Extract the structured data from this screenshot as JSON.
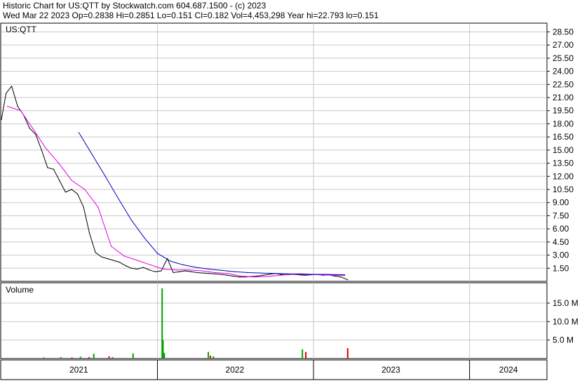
{
  "header": {
    "line1": "Historic Chart for US:QTT by Stockwatch.com 604.687.1500 - (c) 2023",
    "line2": "Wed Mar 22 2023   Op=0.2838   Hi=0.2851   Lo=0.151   Cl=0.182   Vol=4,453,298   Year hi=22.793   lo=0.151"
  },
  "colors": {
    "price": "#000000",
    "ma_short": "#e000e0",
    "ma_long": "#0000c0",
    "vol_up": "#00a000",
    "vol_down": "#e00000",
    "grid": "#c8c8c8"
  },
  "chart_data": [
    {
      "type": "line",
      "title": "US:QTT",
      "ylabel": "",
      "ylim": [
        0,
        29.5
      ],
      "yticks": [
        "1.50",
        "3.00",
        "4.50",
        "6.00",
        "7.50",
        "9.00",
        "10.50",
        "12.00",
        "13.50",
        "15.00",
        "16.50",
        "18.00",
        "19.50",
        "21.00",
        "22.50",
        "24.00",
        "25.50",
        "27.00",
        "28.50"
      ],
      "xlim": [
        "2021-01-01",
        "2024-06-30"
      ],
      "series": [
        {
          "role": "price",
          "x": [
            "2021-01-01",
            "2021-01-12",
            "2021-01-25",
            "2021-02-08",
            "2021-02-22",
            "2021-03-08",
            "2021-03-22",
            "2021-04-05",
            "2021-04-19",
            "2021-05-03",
            "2021-05-17",
            "2021-05-31",
            "2021-06-14",
            "2021-06-28",
            "2021-07-12",
            "2021-07-26",
            "2021-08-09",
            "2021-08-23",
            "2021-09-06",
            "2021-09-20",
            "2021-10-04",
            "2021-10-18",
            "2021-11-01",
            "2021-11-15",
            "2021-11-29",
            "2021-12-13",
            "2021-12-27",
            "2022-01-10",
            "2022-01-24",
            "2022-02-07",
            "2022-02-21",
            "2022-03-07",
            "2022-03-21",
            "2022-04-04",
            "2022-04-18",
            "2022-05-02",
            "2022-05-16",
            "2022-05-30",
            "2022-06-13",
            "2022-06-27",
            "2022-07-11",
            "2022-07-25",
            "2022-08-08",
            "2022-08-22",
            "2022-09-05",
            "2022-09-19",
            "2022-10-03",
            "2022-10-17",
            "2022-10-31",
            "2022-11-14",
            "2022-11-28",
            "2022-12-12",
            "2022-12-26",
            "2023-01-09",
            "2023-01-23",
            "2023-02-06",
            "2023-02-20",
            "2023-03-06",
            "2023-03-22"
          ],
          "y": [
            18.5,
            21.5,
            22.3,
            20.0,
            19.0,
            17.5,
            16.8,
            15.0,
            13.0,
            12.8,
            11.5,
            10.2,
            10.5,
            10.0,
            8.5,
            5.5,
            3.3,
            2.8,
            2.6,
            2.4,
            2.2,
            1.8,
            1.5,
            1.4,
            1.6,
            1.3,
            1.1,
            1.2,
            2.6,
            1.0,
            1.1,
            1.2,
            1.1,
            1.0,
            0.95,
            0.9,
            0.85,
            0.8,
            0.7,
            0.6,
            0.5,
            0.5,
            0.55,
            0.6,
            0.7,
            0.8,
            0.9,
            0.8,
            0.85,
            0.8,
            0.75,
            0.7,
            0.75,
            0.8,
            0.7,
            0.75,
            0.6,
            0.5,
            0.182
          ]
        },
        {
          "role": "ma_short",
          "x": [
            "2021-01-15",
            "2021-02-15",
            "2021-03-15",
            "2021-04-15",
            "2021-05-15",
            "2021-06-15",
            "2021-07-15",
            "2021-08-15",
            "2021-09-15",
            "2021-10-15",
            "2021-11-15",
            "2021-12-15",
            "2022-01-15",
            "2022-02-15",
            "2022-03-15",
            "2022-04-15",
            "2022-05-15",
            "2022-06-15",
            "2022-07-15",
            "2022-08-15",
            "2022-09-15",
            "2022-10-15",
            "2022-11-15",
            "2022-12-15",
            "2023-01-15",
            "2023-02-15",
            "2023-03-15"
          ],
          "y": [
            20.0,
            19.5,
            17.5,
            15.2,
            13.5,
            11.5,
            10.5,
            8.5,
            4.0,
            2.9,
            2.4,
            1.9,
            1.4,
            1.3,
            1.3,
            1.2,
            1.0,
            0.9,
            0.6,
            0.5,
            0.55,
            0.7,
            0.8,
            0.8,
            0.75,
            0.7,
            0.65
          ]
        },
        {
          "role": "ma_long",
          "x": [
            "2021-07-01",
            "2021-08-01",
            "2021-09-01",
            "2021-10-01",
            "2021-11-01",
            "2021-12-01",
            "2022-01-01",
            "2022-02-01",
            "2022-03-01",
            "2022-04-01",
            "2022-05-01",
            "2022-06-01",
            "2022-07-01",
            "2022-08-01",
            "2022-09-01",
            "2022-10-01",
            "2022-11-01",
            "2022-12-01",
            "2023-01-01",
            "2023-02-01",
            "2023-03-15"
          ],
          "y": [
            17.0,
            14.5,
            12.0,
            9.5,
            7.0,
            5.0,
            3.2,
            2.3,
            1.9,
            1.6,
            1.4,
            1.25,
            1.1,
            1.0,
            0.95,
            0.9,
            0.85,
            0.85,
            0.8,
            0.8,
            0.75
          ]
        }
      ]
    },
    {
      "type": "bar",
      "title": "Volume",
      "ylim": [
        0,
        20.5
      ],
      "yticks": [
        "5.0 M",
        "10.0 M",
        "15.0 M"
      ],
      "x": [
        "2021-04-10",
        "2021-05-20",
        "2021-06-15",
        "2021-07-05",
        "2021-07-25",
        "2021-08-05",
        "2021-09-10",
        "2021-09-18",
        "2021-11-05",
        "2022-01-12",
        "2022-01-14",
        "2022-01-17",
        "2022-04-30",
        "2022-05-05",
        "2022-05-12",
        "2022-12-06",
        "2022-12-14",
        "2023-03-22"
      ],
      "values": [
        0.3,
        0.4,
        0.3,
        0.5,
        0.4,
        1.3,
        0.6,
        0.4,
        1.4,
        19.0,
        5.0,
        1.5,
        1.8,
        0.8,
        0.6,
        2.5,
        1.8,
        2.8
      ],
      "up": [
        true,
        true,
        false,
        true,
        false,
        true,
        false,
        true,
        true,
        true,
        true,
        true,
        true,
        false,
        true,
        true,
        false,
        false
      ]
    }
  ],
  "x_axis": {
    "labels": [
      "2021",
      "2022",
      "2023",
      "2024"
    ],
    "dates": [
      "2021-07-01",
      "2022-07-01",
      "2023-07-01",
      "2024-04-01"
    ],
    "dividers": [
      "2022-01-01",
      "2023-01-01",
      "2024-01-01"
    ]
  }
}
